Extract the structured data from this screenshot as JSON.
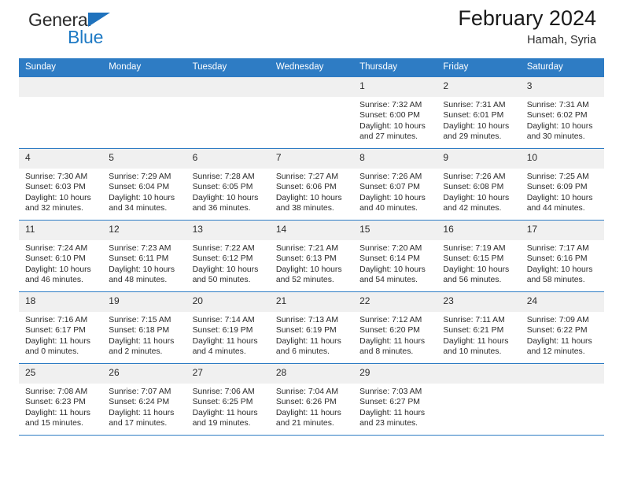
{
  "brand": {
    "line1": "General",
    "line2": "Blue",
    "triangle_color": "#1f72bd",
    "text_color": "#2b2b2b",
    "blue_text_color": "#1f7ac4"
  },
  "header": {
    "title": "February 2024",
    "subtitle": "Hamah, Syria"
  },
  "theme": {
    "header_bg": "#2e7cc4",
    "header_text": "#ffffff",
    "datenum_bg": "#f0f0f0",
    "grid_line": "#2e7cc4"
  },
  "weekday_headers": [
    "Sunday",
    "Monday",
    "Tuesday",
    "Wednesday",
    "Thursday",
    "Friday",
    "Saturday"
  ],
  "labels": {
    "sunrise_prefix": "Sunrise:",
    "sunset_prefix": "Sunset:",
    "daylight_prefix": "Daylight:"
  },
  "weeks": [
    [
      {
        "date": "",
        "sunrise": "",
        "sunset": "",
        "daylight_line1": "",
        "daylight_line2": ""
      },
      {
        "date": "",
        "sunrise": "",
        "sunset": "",
        "daylight_line1": "",
        "daylight_line2": ""
      },
      {
        "date": "",
        "sunrise": "",
        "sunset": "",
        "daylight_line1": "",
        "daylight_line2": ""
      },
      {
        "date": "",
        "sunrise": "",
        "sunset": "",
        "daylight_line1": "",
        "daylight_line2": ""
      },
      {
        "date": "1",
        "sunrise": "Sunrise: 7:32 AM",
        "sunset": "Sunset: 6:00 PM",
        "daylight_line1": "Daylight: 10 hours",
        "daylight_line2": "and 27 minutes."
      },
      {
        "date": "2",
        "sunrise": "Sunrise: 7:31 AM",
        "sunset": "Sunset: 6:01 PM",
        "daylight_line1": "Daylight: 10 hours",
        "daylight_line2": "and 29 minutes."
      },
      {
        "date": "3",
        "sunrise": "Sunrise: 7:31 AM",
        "sunset": "Sunset: 6:02 PM",
        "daylight_line1": "Daylight: 10 hours",
        "daylight_line2": "and 30 minutes."
      }
    ],
    [
      {
        "date": "4",
        "sunrise": "Sunrise: 7:30 AM",
        "sunset": "Sunset: 6:03 PM",
        "daylight_line1": "Daylight: 10 hours",
        "daylight_line2": "and 32 minutes."
      },
      {
        "date": "5",
        "sunrise": "Sunrise: 7:29 AM",
        "sunset": "Sunset: 6:04 PM",
        "daylight_line1": "Daylight: 10 hours",
        "daylight_line2": "and 34 minutes."
      },
      {
        "date": "6",
        "sunrise": "Sunrise: 7:28 AM",
        "sunset": "Sunset: 6:05 PM",
        "daylight_line1": "Daylight: 10 hours",
        "daylight_line2": "and 36 minutes."
      },
      {
        "date": "7",
        "sunrise": "Sunrise: 7:27 AM",
        "sunset": "Sunset: 6:06 PM",
        "daylight_line1": "Daylight: 10 hours",
        "daylight_line2": "and 38 minutes."
      },
      {
        "date": "8",
        "sunrise": "Sunrise: 7:26 AM",
        "sunset": "Sunset: 6:07 PM",
        "daylight_line1": "Daylight: 10 hours",
        "daylight_line2": "and 40 minutes."
      },
      {
        "date": "9",
        "sunrise": "Sunrise: 7:26 AM",
        "sunset": "Sunset: 6:08 PM",
        "daylight_line1": "Daylight: 10 hours",
        "daylight_line2": "and 42 minutes."
      },
      {
        "date": "10",
        "sunrise": "Sunrise: 7:25 AM",
        "sunset": "Sunset: 6:09 PM",
        "daylight_line1": "Daylight: 10 hours",
        "daylight_line2": "and 44 minutes."
      }
    ],
    [
      {
        "date": "11",
        "sunrise": "Sunrise: 7:24 AM",
        "sunset": "Sunset: 6:10 PM",
        "daylight_line1": "Daylight: 10 hours",
        "daylight_line2": "and 46 minutes."
      },
      {
        "date": "12",
        "sunrise": "Sunrise: 7:23 AM",
        "sunset": "Sunset: 6:11 PM",
        "daylight_line1": "Daylight: 10 hours",
        "daylight_line2": "and 48 minutes."
      },
      {
        "date": "13",
        "sunrise": "Sunrise: 7:22 AM",
        "sunset": "Sunset: 6:12 PM",
        "daylight_line1": "Daylight: 10 hours",
        "daylight_line2": "and 50 minutes."
      },
      {
        "date": "14",
        "sunrise": "Sunrise: 7:21 AM",
        "sunset": "Sunset: 6:13 PM",
        "daylight_line1": "Daylight: 10 hours",
        "daylight_line2": "and 52 minutes."
      },
      {
        "date": "15",
        "sunrise": "Sunrise: 7:20 AM",
        "sunset": "Sunset: 6:14 PM",
        "daylight_line1": "Daylight: 10 hours",
        "daylight_line2": "and 54 minutes."
      },
      {
        "date": "16",
        "sunrise": "Sunrise: 7:19 AM",
        "sunset": "Sunset: 6:15 PM",
        "daylight_line1": "Daylight: 10 hours",
        "daylight_line2": "and 56 minutes."
      },
      {
        "date": "17",
        "sunrise": "Sunrise: 7:17 AM",
        "sunset": "Sunset: 6:16 PM",
        "daylight_line1": "Daylight: 10 hours",
        "daylight_line2": "and 58 minutes."
      }
    ],
    [
      {
        "date": "18",
        "sunrise": "Sunrise: 7:16 AM",
        "sunset": "Sunset: 6:17 PM",
        "daylight_line1": "Daylight: 11 hours",
        "daylight_line2": "and 0 minutes."
      },
      {
        "date": "19",
        "sunrise": "Sunrise: 7:15 AM",
        "sunset": "Sunset: 6:18 PM",
        "daylight_line1": "Daylight: 11 hours",
        "daylight_line2": "and 2 minutes."
      },
      {
        "date": "20",
        "sunrise": "Sunrise: 7:14 AM",
        "sunset": "Sunset: 6:19 PM",
        "daylight_line1": "Daylight: 11 hours",
        "daylight_line2": "and 4 minutes."
      },
      {
        "date": "21",
        "sunrise": "Sunrise: 7:13 AM",
        "sunset": "Sunset: 6:19 PM",
        "daylight_line1": "Daylight: 11 hours",
        "daylight_line2": "and 6 minutes."
      },
      {
        "date": "22",
        "sunrise": "Sunrise: 7:12 AM",
        "sunset": "Sunset: 6:20 PM",
        "daylight_line1": "Daylight: 11 hours",
        "daylight_line2": "and 8 minutes."
      },
      {
        "date": "23",
        "sunrise": "Sunrise: 7:11 AM",
        "sunset": "Sunset: 6:21 PM",
        "daylight_line1": "Daylight: 11 hours",
        "daylight_line2": "and 10 minutes."
      },
      {
        "date": "24",
        "sunrise": "Sunrise: 7:09 AM",
        "sunset": "Sunset: 6:22 PM",
        "daylight_line1": "Daylight: 11 hours",
        "daylight_line2": "and 12 minutes."
      }
    ],
    [
      {
        "date": "25",
        "sunrise": "Sunrise: 7:08 AM",
        "sunset": "Sunset: 6:23 PM",
        "daylight_line1": "Daylight: 11 hours",
        "daylight_line2": "and 15 minutes."
      },
      {
        "date": "26",
        "sunrise": "Sunrise: 7:07 AM",
        "sunset": "Sunset: 6:24 PM",
        "daylight_line1": "Daylight: 11 hours",
        "daylight_line2": "and 17 minutes."
      },
      {
        "date": "27",
        "sunrise": "Sunrise: 7:06 AM",
        "sunset": "Sunset: 6:25 PM",
        "daylight_line1": "Daylight: 11 hours",
        "daylight_line2": "and 19 minutes."
      },
      {
        "date": "28",
        "sunrise": "Sunrise: 7:04 AM",
        "sunset": "Sunset: 6:26 PM",
        "daylight_line1": "Daylight: 11 hours",
        "daylight_line2": "and 21 minutes."
      },
      {
        "date": "29",
        "sunrise": "Sunrise: 7:03 AM",
        "sunset": "Sunset: 6:27 PM",
        "daylight_line1": "Daylight: 11 hours",
        "daylight_line2": "and 23 minutes."
      },
      {
        "date": "",
        "sunrise": "",
        "sunset": "",
        "daylight_line1": "",
        "daylight_line2": ""
      },
      {
        "date": "",
        "sunrise": "",
        "sunset": "",
        "daylight_line1": "",
        "daylight_line2": ""
      }
    ]
  ]
}
